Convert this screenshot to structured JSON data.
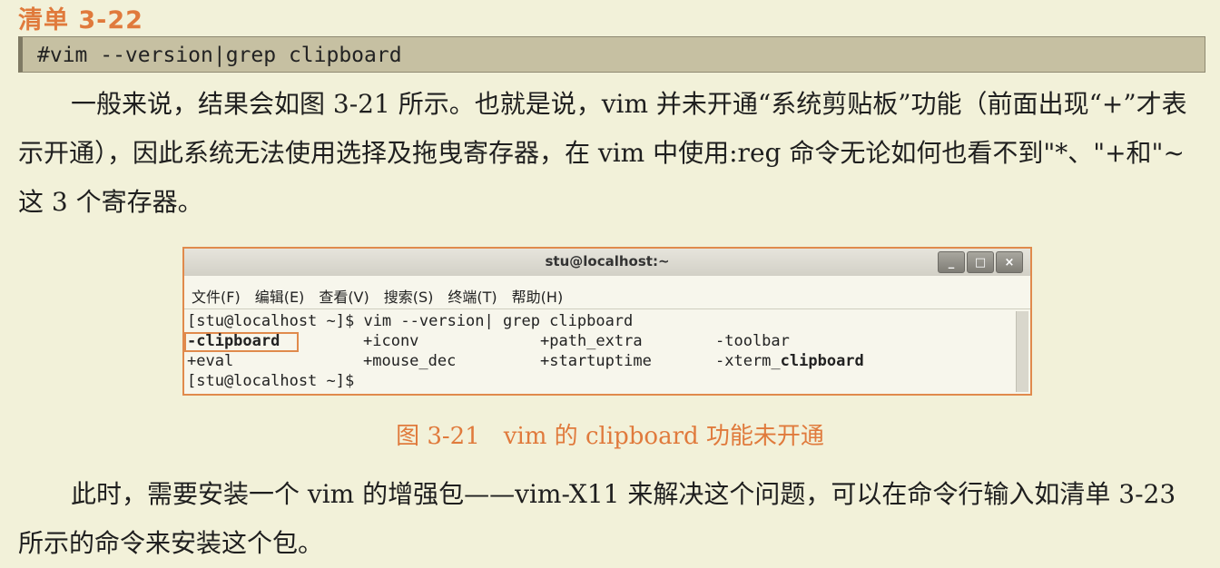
{
  "listing_title": "清单 3-22",
  "code_command": "#vim --version|grep clipboard",
  "paragraph1": "一般来说，结果会如图 3-21 所示。也就是说，vim 并未开通“系统剪贴板”功能（前面出现“+”才表示开通），因此系统无法使用选择及拖曳寄存器，在 vim 中使用:reg 命令无论如何也看不到\"*、\"+和\"~这 3 个寄存器。",
  "terminal": {
    "title": "stu@localhost:~",
    "window_buttons": [
      "_",
      "□",
      "×"
    ],
    "menu": [
      "文件(F)",
      "编辑(E)",
      "查看(V)",
      "搜索(S)",
      "终端(T)",
      "帮助(H)"
    ],
    "lines": {
      "prompt1": "[stu@localhost ~]$ vim --version| grep clipboard",
      "r1c1": "-clipboard",
      "r1c2": "+iconv",
      "r1c3": "+path_extra",
      "r1c4": "-toolbar",
      "r2c1": "+eval",
      "r2c2": "+mouse_dec",
      "r2c3": "+startuptime",
      "r2c4_prefix": "-xterm_",
      "r2c4_bold": "clipboard",
      "prompt2": "[stu@localhost ~]$"
    }
  },
  "caption": "图 3-21　vim 的 clipboard 功能未开通",
  "paragraph2": "此时，需要安装一个 vim 的增强包——vim-X11 来解决这个问题，可以在命令行输入如清单 3-23 所示的命令来安装这个包。"
}
